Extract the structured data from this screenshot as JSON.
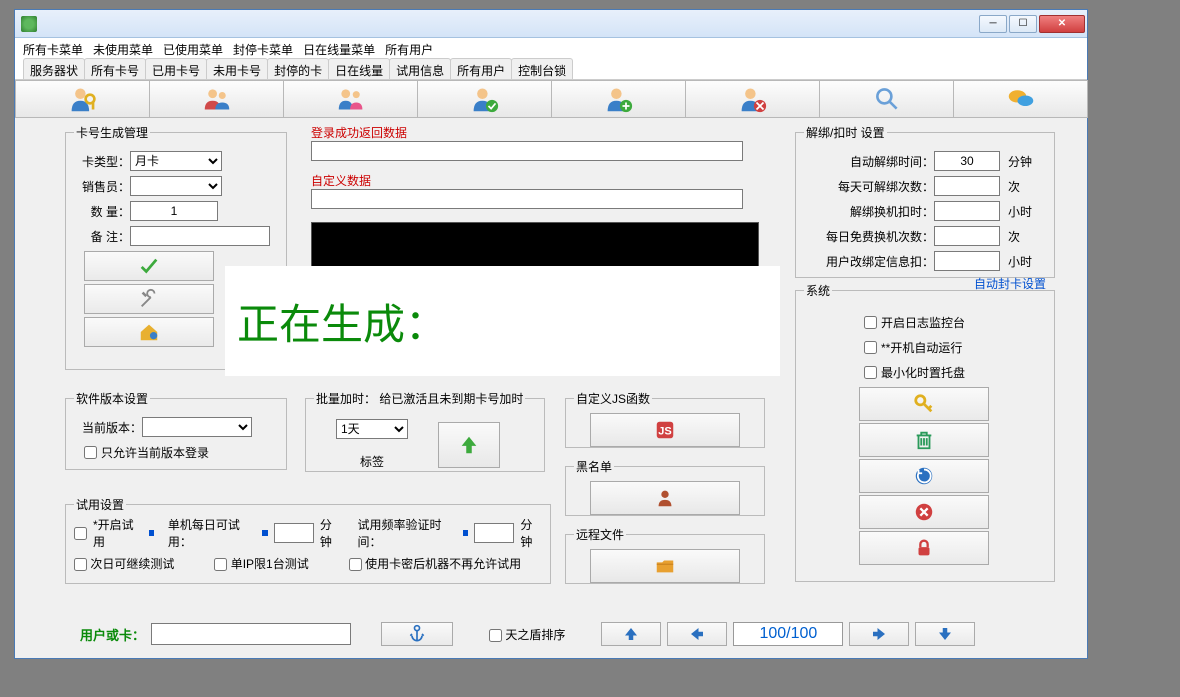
{
  "window": {
    "title": ""
  },
  "menu": [
    "所有卡菜单",
    "未使用菜单",
    "已使用菜单",
    "封停卡菜单",
    "日在线量菜单",
    "所有用户"
  ],
  "tabs": [
    "服务器状",
    "所有卡号",
    "已用卡号",
    "未用卡号",
    "封停的卡",
    "日在线量",
    "试用信息",
    "所有用户",
    "控制台锁"
  ],
  "cardgen": {
    "legend": "卡号生成管理",
    "type_label": "卡类型：",
    "type_value": "月卡",
    "seller_label": "销售员：",
    "seller_value": "",
    "qty_label": "数  量：",
    "qty_value": "1",
    "remark_label": "备  注：",
    "remark_value": ""
  },
  "login_data": {
    "label": "登录成功返回数据",
    "value": ""
  },
  "custom_data": {
    "label": "自定义数据",
    "value": ""
  },
  "unbind": {
    "legend": "解绑/扣时  设置",
    "rows": [
      {
        "label": "自动解绑时间：",
        "value": "30",
        "unit": "分钟"
      },
      {
        "label": "每天可解绑次数：",
        "value": "",
        "unit": "次"
      },
      {
        "label": "解绑换机扣时：",
        "value": "",
        "unit": "小时"
      },
      {
        "label": "每日免费换机次数：",
        "value": "",
        "unit": "次"
      },
      {
        "label": "用户改绑定信息扣：",
        "value": "",
        "unit": "小时"
      }
    ],
    "auto_ban_link": "自动封卡设置"
  },
  "system": {
    "legend": "系统",
    "checks": [
      "开启日志监控台",
      "**开机自动运行",
      "最小化时置托盘"
    ]
  },
  "version": {
    "legend": "软件版本设置",
    "cur_label": "当前版本：",
    "cur_value": "",
    "only_current": "只允许当前版本登录"
  },
  "batch": {
    "legend": "批量加时： 给已激活且未到期卡号加时",
    "days_value": "1天",
    "tag_label": "标签"
  },
  "customjs": {
    "legend": "自定义JS函数"
  },
  "blacklist": {
    "legend": "黑名单"
  },
  "remotefile": {
    "legend": "远程文件"
  },
  "trial": {
    "legend": "试用设置",
    "enable": "*开启试用",
    "per_machine_label": "单机每日可试用：",
    "per_machine_unit": "分钟",
    "freq_label": "试用频率验证时间：",
    "freq_unit": "分钟",
    "next_day": "次日可继续测试",
    "single_ip": "单IP限1台测试",
    "no_more": "使用卡密后机器不再允许试用"
  },
  "footer": {
    "user_label": "用户或卡：",
    "tianzhidun": "天之盾排序",
    "page": "100/100"
  },
  "overlay": {
    "text": "正在生成："
  }
}
